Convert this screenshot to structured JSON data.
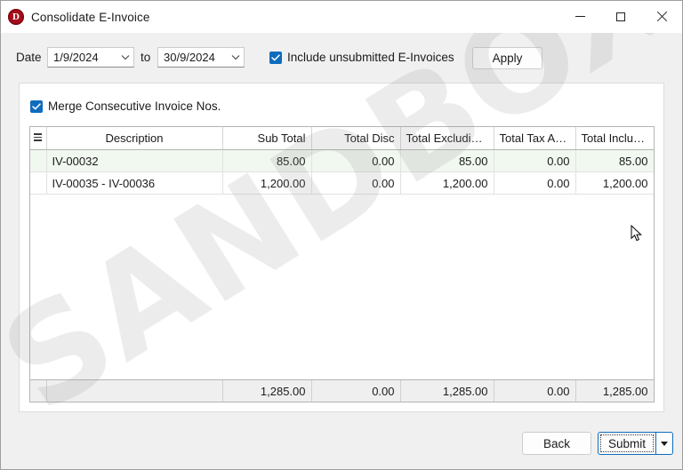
{
  "window": {
    "title": "Consolidate E-Invoice",
    "app_icon": "app-logo-d",
    "icon_letter": "D",
    "controls": {
      "minimize": "minimize-icon",
      "maximize": "maximize-icon",
      "close": "close-icon"
    }
  },
  "toolbar": {
    "date_label": "Date",
    "date_from": "1/9/2024",
    "to_label": "to",
    "date_to": "30/9/2024",
    "include_unsubmitted_label": "Include unsubmitted E-Invoices",
    "include_unsubmitted_checked": true,
    "apply_label": "Apply"
  },
  "panel": {
    "merge_label": "Merge Consecutive Invoice Nos.",
    "merge_checked": true
  },
  "grid": {
    "row_selector_icon": "grid-grip-icon",
    "columns": [
      "Description",
      "Sub Total",
      "Total Disc",
      "Total Excluding...",
      "Total Tax Amo...",
      "Total Including..."
    ],
    "rows": [
      {
        "description": "IV-00032",
        "sub_total": "85.00",
        "total_disc": "0.00",
        "total_excluding": "85.00",
        "total_tax_amount": "0.00",
        "total_including": "85.00",
        "highlighted": true
      },
      {
        "description": "IV-00035 - IV-00036",
        "sub_total": "1,200.00",
        "total_disc": "0.00",
        "total_excluding": "1,200.00",
        "total_tax_amount": "0.00",
        "total_including": "1,200.00",
        "highlighted": false
      }
    ],
    "totals": {
      "description": "",
      "sub_total": "1,285.00",
      "total_disc": "0.00",
      "total_excluding": "1,285.00",
      "total_tax_amount": "0.00",
      "total_including": "1,285.00"
    }
  },
  "footer": {
    "back_label": "Back",
    "submit_label": "Submit",
    "submit_dropdown_icon": "chevron-down-icon"
  },
  "watermark": {
    "text": "SANDBOX"
  },
  "colors": {
    "accent": "#0f6cbd",
    "logo": "#a50d1a",
    "row_highlight": "#f1f8f0",
    "window_bg": "#f0f0f0"
  }
}
